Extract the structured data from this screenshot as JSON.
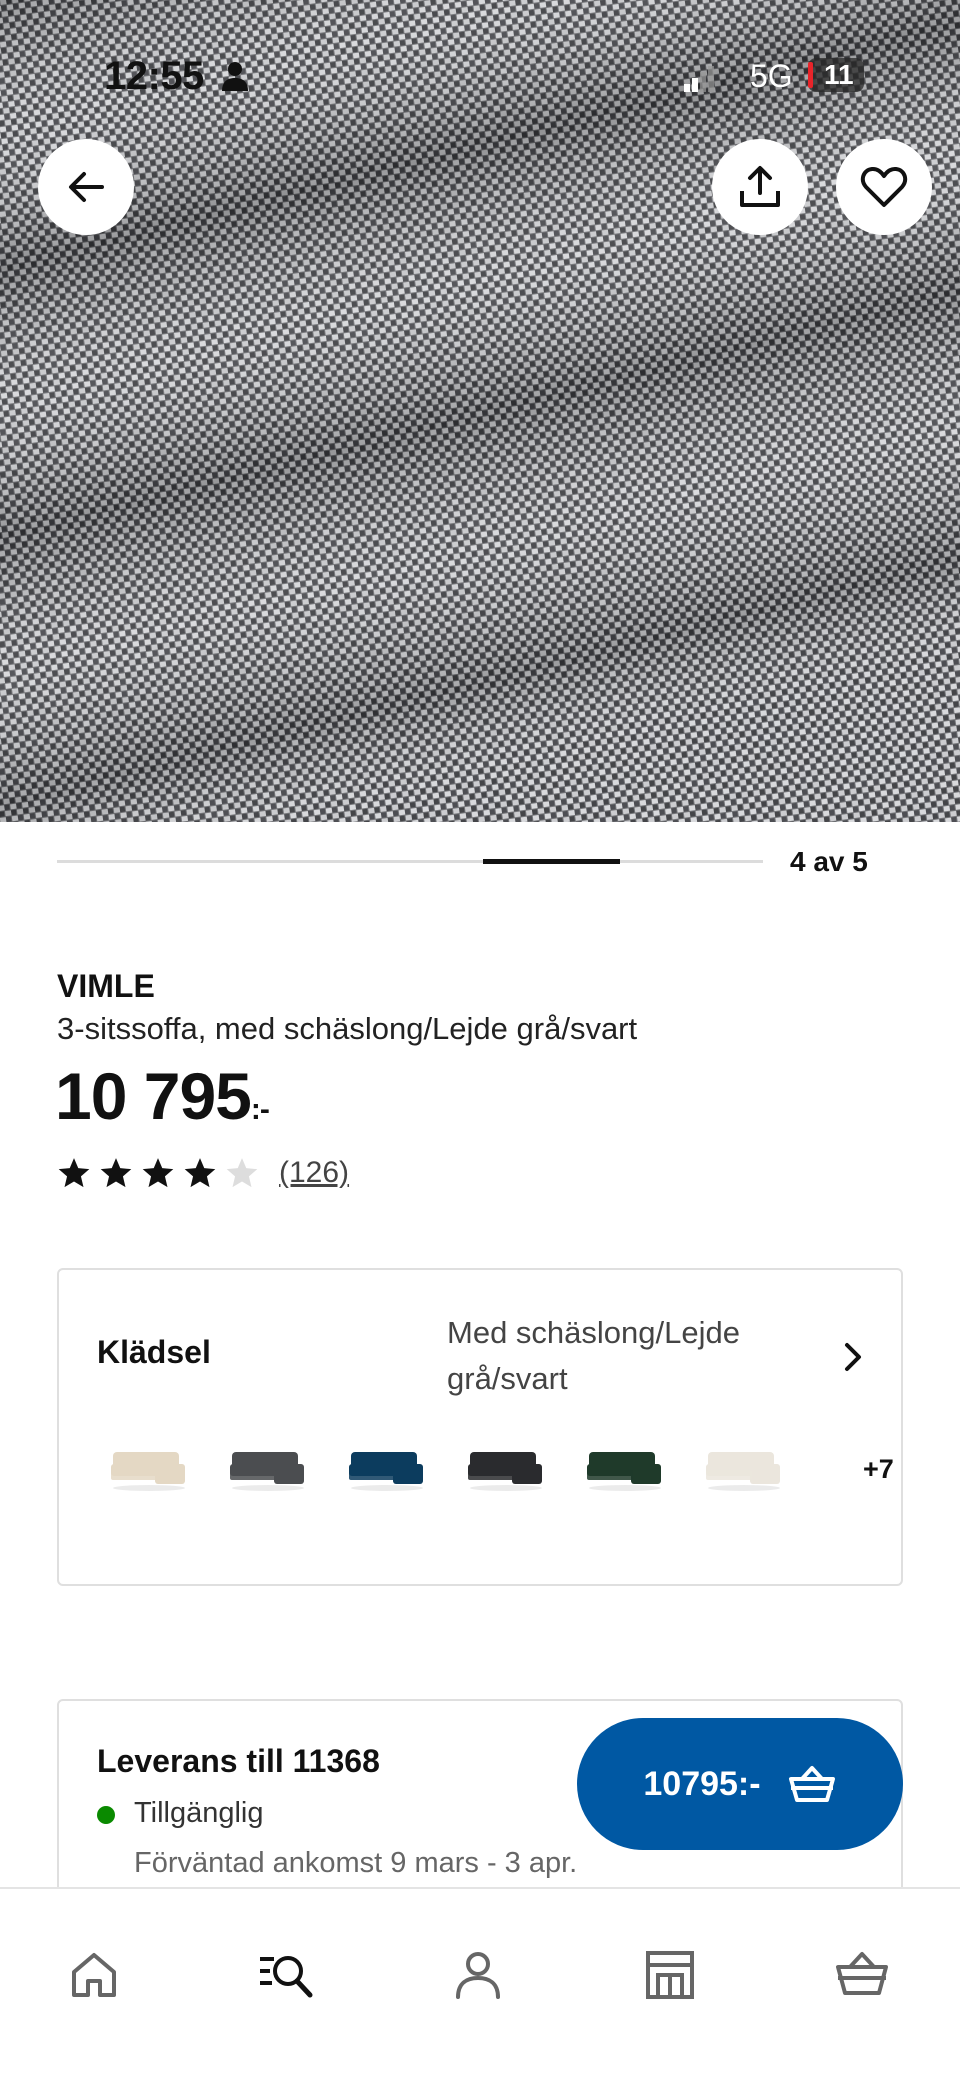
{
  "status_bar": {
    "time": "12:55",
    "network": "5G",
    "battery": "11"
  },
  "gallery": {
    "page_indicator": "4 av 5",
    "current_index": 4,
    "total": 5
  },
  "product": {
    "name": "VIMLE",
    "description": "3-sitssoffa, med schäslong/Lejde grå/svart",
    "price": "10 795",
    "price_suffix": ":-",
    "rating": 4,
    "rating_max": 5,
    "review_count": "(126)"
  },
  "upholstery": {
    "label": "Klädsel",
    "value": "Med schäslong/Lejde grå/svart",
    "more_count": "+7",
    "swatches": [
      {
        "name": "beige",
        "color": "#e4d8c4"
      },
      {
        "name": "dark-grey",
        "color": "#4b4d50"
      },
      {
        "name": "dark-blue",
        "color": "#0c3c5e"
      },
      {
        "name": "black",
        "color": "#2a2b2e"
      },
      {
        "name": "dark-green",
        "color": "#1f3a2a"
      },
      {
        "name": "light-beige",
        "color": "#ebe6dd"
      }
    ]
  },
  "delivery": {
    "title": "Leverans till 11368",
    "availability": "Tillgänglig",
    "availability_color": "#0a8a00",
    "eta": "Förväntad ankomst 9 mars - 3 apr."
  },
  "cart_button": {
    "price": "10795:-",
    "icon": "basket-icon",
    "color": "#0058a3"
  },
  "bottom_nav": {
    "items": [
      {
        "name": "home",
        "icon": "home-icon"
      },
      {
        "name": "search",
        "icon": "search-icon",
        "active": true
      },
      {
        "name": "profile",
        "icon": "profile-icon"
      },
      {
        "name": "store",
        "icon": "store-icon"
      },
      {
        "name": "cart",
        "icon": "basket-icon"
      }
    ]
  },
  "icons": {
    "back": "arrow-left-icon",
    "share": "share-icon",
    "favorite": "heart-icon"
  }
}
